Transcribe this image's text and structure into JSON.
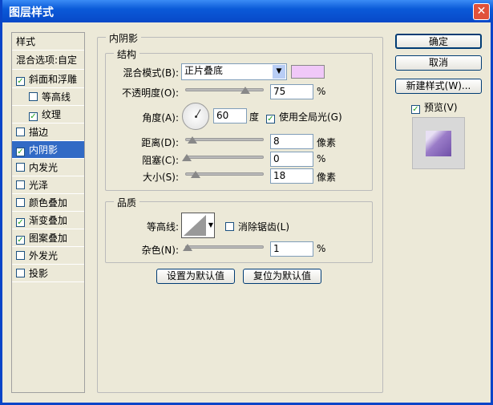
{
  "title": "图层样式",
  "sidebar": {
    "header": "样式",
    "blend": "混合选项:自定",
    "items": [
      {
        "label": "斜面和浮雕",
        "checked": true
      },
      {
        "label": "等高线",
        "checked": false
      },
      {
        "label": "纹理",
        "checked": true
      },
      {
        "label": "描边",
        "checked": false
      },
      {
        "label": "内阴影",
        "checked": true
      },
      {
        "label": "内发光",
        "checked": false
      },
      {
        "label": "光泽",
        "checked": false
      },
      {
        "label": "颜色叠加",
        "checked": false
      },
      {
        "label": "渐变叠加",
        "checked": true
      },
      {
        "label": "图案叠加",
        "checked": true
      },
      {
        "label": "外发光",
        "checked": false
      },
      {
        "label": "投影",
        "checked": false
      }
    ]
  },
  "panel": {
    "title": "内阴影",
    "structure": {
      "title": "结构",
      "blend_label": "混合模式(B):",
      "blend_value": "正片叠底",
      "color": "#f0c8f8",
      "opacity_label": "不透明度(O):",
      "opacity": "75",
      "opacity_unit": "%",
      "angle_label": "角度(A):",
      "angle": "60",
      "angle_unit": "度",
      "global_light": "使用全局光(G)",
      "distance_label": "距离(D):",
      "distance": "8",
      "distance_unit": "像素",
      "choke_label": "阻塞(C):",
      "choke": "0",
      "choke_unit": "%",
      "size_label": "大小(S):",
      "size": "18",
      "size_unit": "像素"
    },
    "quality": {
      "title": "品质",
      "contour_label": "等高线:",
      "antialias": "消除锯齿(L)",
      "noise_label": "杂色(N):",
      "noise": "1",
      "noise_unit": "%"
    },
    "set_default": "设置为默认值",
    "reset_default": "复位为默认值"
  },
  "buttons": {
    "ok": "确定",
    "cancel": "取消",
    "new_style": "新建样式(W)...",
    "preview": "预览(V)"
  }
}
